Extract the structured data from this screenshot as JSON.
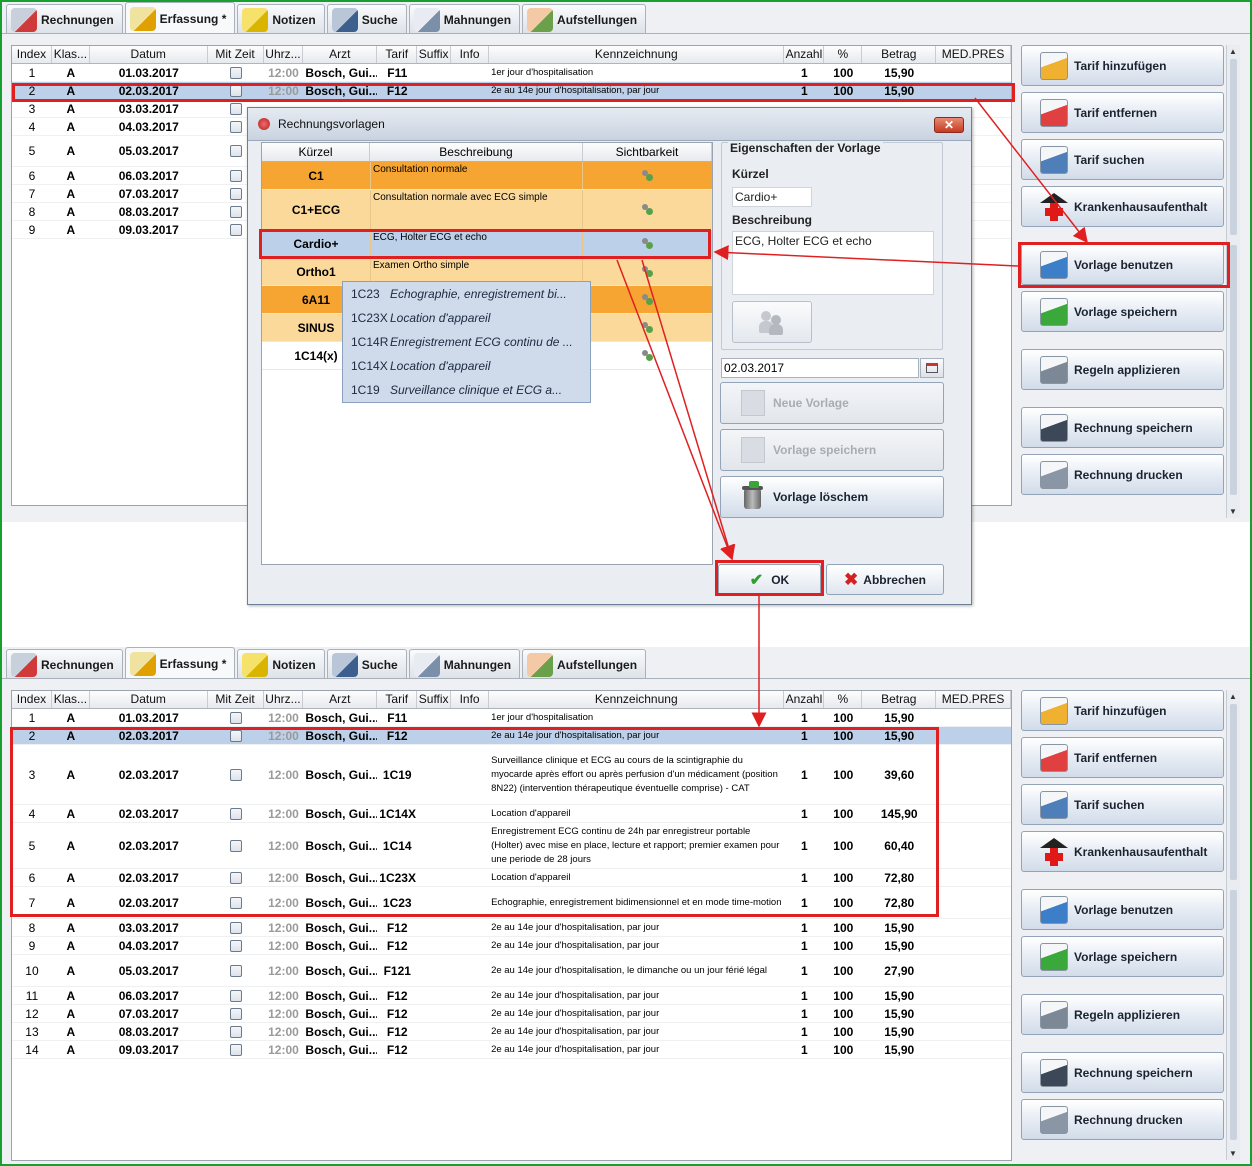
{
  "tabs": [
    {
      "label": "Rechnungen",
      "icon": "invoice-person-icon"
    },
    {
      "label": "Erfassung *",
      "icon": "pencil-form-icon"
    },
    {
      "label": "Notizen",
      "icon": "sticky-note-icon"
    },
    {
      "label": "Suche",
      "icon": "search-binoculars-icon"
    },
    {
      "label": "Mahnungen",
      "icon": "envelope-icon"
    },
    {
      "label": "Aufstellungen",
      "icon": "report-icon"
    }
  ],
  "columns": [
    "Index",
    "Klas...",
    "Datum",
    "Mit Zeit",
    "Uhrz...",
    "Arzt",
    "Tarif",
    "Suffix",
    "Info",
    "Kennzeichnung",
    "Anzahl",
    "%",
    "Betrag",
    "MED.PRES"
  ],
  "top_rows": [
    {
      "index": "1",
      "klasse": "A",
      "datum": "01.03.2017",
      "uhrzeit": "12:00",
      "arzt": "Bosch, Gui...",
      "tarif": "F11",
      "kenn": "1er jour d'hospitalisation",
      "anzahl": "1",
      "pct": "100",
      "betrag": "15,90"
    },
    {
      "index": "2",
      "klasse": "A",
      "datum": "02.03.2017",
      "uhrzeit": "12:00",
      "arzt": "Bosch, Gui...",
      "tarif": "F12",
      "kenn": "2e au 14e jour d'hospitalisation, par jour",
      "anzahl": "1",
      "pct": "100",
      "betrag": "15,90"
    },
    {
      "index": "3",
      "klasse": "A",
      "datum": "03.03.2017"
    },
    {
      "index": "4",
      "klasse": "A",
      "datum": "04.03.2017"
    },
    {
      "index": "5",
      "klasse": "A",
      "datum": "05.03.2017"
    },
    {
      "index": "6",
      "klasse": "A",
      "datum": "06.03.2017"
    },
    {
      "index": "7",
      "klasse": "A",
      "datum": "07.03.2017"
    },
    {
      "index": "8",
      "klasse": "A",
      "datum": "08.03.2017"
    },
    {
      "index": "9",
      "klasse": "A",
      "datum": "09.03.2017"
    }
  ],
  "bottom_rows": [
    {
      "index": "1",
      "klasse": "A",
      "datum": "01.03.2017",
      "uhrzeit": "12:00",
      "arzt": "Bosch, Gui...",
      "tarif": "F11",
      "kenn": "1er jour d'hospitalisation",
      "anzahl": "1",
      "pct": "100",
      "betrag": "15,90"
    },
    {
      "index": "2",
      "klasse": "A",
      "datum": "02.03.2017",
      "uhrzeit": "12:00",
      "arzt": "Bosch, Gui...",
      "tarif": "F12",
      "kenn": "2e au 14e jour d'hospitalisation, par jour",
      "anzahl": "1",
      "pct": "100",
      "betrag": "15,90"
    },
    {
      "index": "3",
      "klasse": "A",
      "datum": "02.03.2017",
      "uhrzeit": "12:00",
      "arzt": "Bosch, Gui...",
      "tarif": "1C19",
      "kenn": "Surveillance clinique et ECG au cours de la scintigraphie du myocarde après effort ou après perfusion d'un médicament (position 8N22) (intervention thérapeutique éventuelle comprise) - CAT",
      "anzahl": "1",
      "pct": "100",
      "betrag": "39,60"
    },
    {
      "index": "4",
      "klasse": "A",
      "datum": "02.03.2017",
      "uhrzeit": "12:00",
      "arzt": "Bosch, Gui...",
      "tarif": "1C14X",
      "kenn": "Location d'appareil",
      "anzahl": "1",
      "pct": "100",
      "betrag": "145,90"
    },
    {
      "index": "5",
      "klasse": "A",
      "datum": "02.03.2017",
      "uhrzeit": "12:00",
      "arzt": "Bosch, Gui...",
      "tarif": "1C14",
      "kenn": "Enregistrement ECG continu de 24h par enregistreur portable (Holter) avec mise en place, lecture et rapport; premier examen pour une periode de 28 jours",
      "anzahl": "1",
      "pct": "100",
      "betrag": "60,40"
    },
    {
      "index": "6",
      "klasse": "A",
      "datum": "02.03.2017",
      "uhrzeit": "12:00",
      "arzt": "Bosch, Gui...",
      "tarif": "1C23X",
      "kenn": "Location d'appareil",
      "anzahl": "1",
      "pct": "100",
      "betrag": "72,80"
    },
    {
      "index": "7",
      "klasse": "A",
      "datum": "02.03.2017",
      "uhrzeit": "12:00",
      "arzt": "Bosch, Gui...",
      "tarif": "1C23",
      "kenn": "Echographie, enregistrement bidimensionnel et en mode time-motion",
      "anzahl": "1",
      "pct": "100",
      "betrag": "72,80"
    },
    {
      "index": "8",
      "klasse": "A",
      "datum": "03.03.2017",
      "uhrzeit": "12:00",
      "arzt": "Bosch, Gui...",
      "tarif": "F12",
      "kenn": "2e au 14e jour d'hospitalisation, par jour",
      "anzahl": "1",
      "pct": "100",
      "betrag": "15,90"
    },
    {
      "index": "9",
      "klasse": "A",
      "datum": "04.03.2017",
      "uhrzeit": "12:00",
      "arzt": "Bosch, Gui...",
      "tarif": "F12",
      "kenn": "2e au 14e jour d'hospitalisation, par jour",
      "anzahl": "1",
      "pct": "100",
      "betrag": "15,90"
    },
    {
      "index": "10",
      "klasse": "A",
      "datum": "05.03.2017",
      "uhrzeit": "12:00",
      "arzt": "Bosch, Gui...",
      "tarif": "F121",
      "kenn": "2e au 14e jour d'hospitalisation, le dimanche ou un jour férié légal",
      "anzahl": "1",
      "pct": "100",
      "betrag": "27,90"
    },
    {
      "index": "11",
      "klasse": "A",
      "datum": "06.03.2017",
      "uhrzeit": "12:00",
      "arzt": "Bosch, Gui...",
      "tarif": "F12",
      "kenn": "2e au 14e jour d'hospitalisation, par jour",
      "anzahl": "1",
      "pct": "100",
      "betrag": "15,90"
    },
    {
      "index": "12",
      "klasse": "A",
      "datum": "07.03.2017",
      "uhrzeit": "12:00",
      "arzt": "Bosch, Gui...",
      "tarif": "F12",
      "kenn": "2e au 14e jour d'hospitalisation, par jour",
      "anzahl": "1",
      "pct": "100",
      "betrag": "15,90"
    },
    {
      "index": "13",
      "klasse": "A",
      "datum": "08.03.2017",
      "uhrzeit": "12:00",
      "arzt": "Bosch, Gui...",
      "tarif": "F12",
      "kenn": "2e au 14e jour d'hospitalisation, par jour",
      "anzahl": "1",
      "pct": "100",
      "betrag": "15,90"
    },
    {
      "index": "14",
      "klasse": "A",
      "datum": "09.03.2017",
      "uhrzeit": "12:00",
      "arzt": "Bosch, Gui...",
      "tarif": "F12",
      "kenn": "2e au 14e jour d'hospitalisation, par jour",
      "anzahl": "1",
      "pct": "100",
      "betrag": "15,90"
    }
  ],
  "sidebar_buttons": [
    {
      "label": "Tarif hinzufügen",
      "icon": "tarif-add-icon"
    },
    {
      "label": "Tarif entfernen",
      "icon": "tarif-remove-icon"
    },
    {
      "label": "Tarif suchen",
      "icon": "tarif-search-icon"
    },
    {
      "label": "Krankenhausaufenthalt",
      "icon": "hospital-cross-icon"
    },
    {
      "label": "Vorlage benutzen",
      "icon": "folder-open-icon"
    },
    {
      "label": "Vorlage speichern",
      "icon": "template-save-icon"
    },
    {
      "label": "Regeln applizieren",
      "icon": "gears-icon"
    },
    {
      "label": "Rechnung speichern",
      "icon": "floppy-disk-icon"
    },
    {
      "label": "Rechnung drucken",
      "icon": "printer-icon"
    }
  ],
  "dialog": {
    "title": "Rechnungsvorlagen",
    "close": "✕",
    "columns": [
      "Kürzel",
      "Beschreibung",
      "Sichtbarkeit"
    ],
    "templates": [
      {
        "kuerzel": "C1",
        "beschreibung": "Consultation normale",
        "style": "or"
      },
      {
        "kuerzel": "C1+ECG",
        "beschreibung": "Consultation normale avec ECG simple",
        "style": "lo"
      },
      {
        "kuerzel": "Cardio+",
        "beschreibung": "ECG, Holter ECG et echo",
        "style": "selrow"
      },
      {
        "kuerzel": "Ortho1",
        "beschreibung": "Examen Ortho simple",
        "style": "lo"
      },
      {
        "kuerzel": "6A11",
        "beschreibung": "",
        "style": "or"
      },
      {
        "kuerzel": "SINUS",
        "beschreibung": "",
        "style": "lo"
      },
      {
        "kuerzel": "1C14(x)",
        "beschreibung": "",
        "style": "wh"
      }
    ],
    "popup": [
      {
        "code": "1C23",
        "desc": "Echographie, enregistrement bi..."
      },
      {
        "code": "1C23X",
        "desc": "Location d'appareil"
      },
      {
        "code": "1C14R",
        "desc": "Enregistrement ECG continu de ..."
      },
      {
        "code": "1C14X",
        "desc": "Location d'appareil"
      },
      {
        "code": "1C19",
        "desc": "Surveillance clinique et ECG a..."
      }
    ],
    "properties_title": "Eigenschaften der Vorlage",
    "kuerzel_label": "Kürzel",
    "kuerzel_value": "Cardio+",
    "beschreibung_label": "Beschreibung",
    "beschreibung_value": "ECG, Holter ECG et echo",
    "date_value": "02.03.2017",
    "btn_neue": "Neue Vorlage",
    "btn_speichern": "Vorlage speichern",
    "btn_loeschen": "Vorlage löschem",
    "ok": "OK",
    "cancel": "Abbrechen"
  },
  "colors": {
    "highlight": "#e02020",
    "orange": "#f7a532",
    "light_orange": "#fbd99a",
    "selection": "#bcd0e9",
    "frame": "#17a02f"
  }
}
